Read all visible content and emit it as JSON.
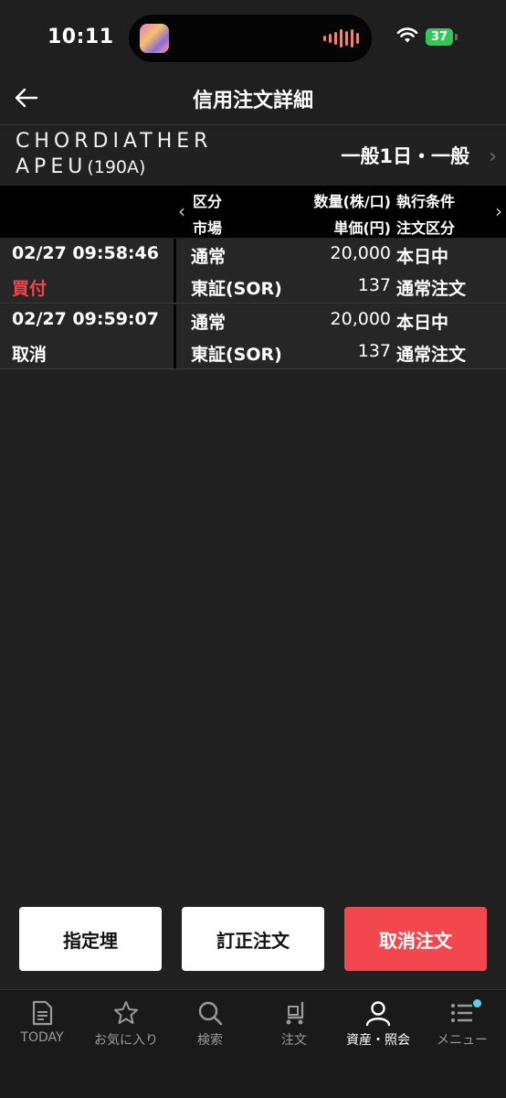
{
  "status_bar": {
    "time": "10:11",
    "battery": "37"
  },
  "nav": {
    "title": "信用注文詳細"
  },
  "stock": {
    "name_line1": "CHORDIATHER",
    "name_line2": "APEU",
    "code": "(190A)",
    "order_type": "一般1日・一般"
  },
  "table_header": {
    "kubun": "区分",
    "market": "市場",
    "quantity": "数量(株/口)",
    "unit_price": "単価(円)",
    "exec_condition": "執行条件",
    "order_kind": "注文区分"
  },
  "rows": [
    {
      "datetime": "02/27 09:58:46",
      "action": "買付",
      "kubun": "通常",
      "market": "東証(SOR)",
      "quantity": "20,000",
      "price": "137",
      "condition": "本日中",
      "order_kind": "通常注文"
    },
    {
      "datetime": "02/27 09:59:07",
      "action": "取消",
      "kubun": "通常",
      "market": "東証(SOR)",
      "quantity": "20,000",
      "price": "137",
      "condition": "本日中",
      "order_kind": "通常注文"
    }
  ],
  "actions": {
    "designate": "指定埋",
    "modify": "訂正注文",
    "cancel": "取消注文"
  },
  "tabs": [
    {
      "label": "TODAY",
      "icon": "today-icon"
    },
    {
      "label": "お気に入り",
      "icon": "star-icon"
    },
    {
      "label": "検索",
      "icon": "search-icon"
    },
    {
      "label": "注文",
      "icon": "cart-icon"
    },
    {
      "label": "資産・照会",
      "icon": "person-icon"
    },
    {
      "label": "メニュー",
      "icon": "menu-icon"
    }
  ],
  "colors": {
    "buy": "#f0464c",
    "cancel_button": "#f3474f",
    "background": "#212121"
  }
}
